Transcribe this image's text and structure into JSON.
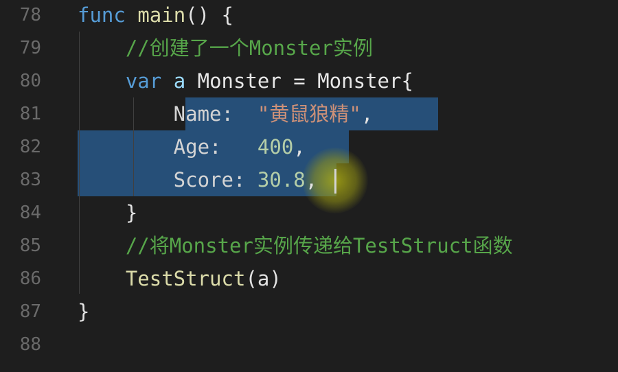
{
  "editor": {
    "lines": [
      {
        "num": "78",
        "tokens": [
          {
            "t": "func",
            "c": "kw"
          },
          {
            "t": " ",
            "c": "plain"
          },
          {
            "t": "main",
            "c": "fn"
          },
          {
            "t": "() {",
            "c": "plain"
          }
        ]
      },
      {
        "num": "79",
        "tokens": [
          {
            "t": "    //创建了一个Monster实例",
            "c": "cm"
          }
        ]
      },
      {
        "num": "80",
        "tokens": [
          {
            "t": "    ",
            "c": "plain"
          },
          {
            "t": "var",
            "c": "kw"
          },
          {
            "t": " ",
            "c": "plain"
          },
          {
            "t": "a",
            "c": "var"
          },
          {
            "t": " Monster = Monster{",
            "c": "type"
          }
        ]
      },
      {
        "num": "81",
        "tokens": [
          {
            "t": "        Name:  ",
            "c": "key"
          },
          {
            "t": "\"黄鼠狼精\"",
            "c": "str"
          },
          {
            "t": ",",
            "c": "plain"
          }
        ]
      },
      {
        "num": "82",
        "tokens": [
          {
            "t": "        Age:   ",
            "c": "key"
          },
          {
            "t": "400",
            "c": "num"
          },
          {
            "t": ",",
            "c": "plain"
          }
        ]
      },
      {
        "num": "83",
        "tokens": [
          {
            "t": "        Score: ",
            "c": "key"
          },
          {
            "t": "30.8",
            "c": "num"
          },
          {
            "t": ",",
            "c": "plain"
          }
        ]
      },
      {
        "num": "84",
        "tokens": [
          {
            "t": "    }",
            "c": "plain"
          }
        ]
      },
      {
        "num": "85",
        "tokens": [
          {
            "t": "    //将Monster实例传递给TestStruct函数",
            "c": "cm"
          }
        ]
      },
      {
        "num": "86",
        "tokens": [
          {
            "t": "    ",
            "c": "plain"
          },
          {
            "t": "TestStruct",
            "c": "fn"
          },
          {
            "t": "(a)",
            "c": "plain"
          }
        ]
      },
      {
        "num": "87",
        "tokens": [
          {
            "t": "}",
            "c": "plain"
          }
        ]
      },
      {
        "num": "88",
        "tokens": []
      }
    ]
  },
  "colors": {
    "background": "#1e1e1e",
    "selection": "#264f78",
    "keyword": "#569cd6",
    "function": "#dcdcaa",
    "comment": "#57a64a",
    "string": "#ce9178",
    "number": "#b5cea8",
    "line_number": "#6a6a6a"
  }
}
